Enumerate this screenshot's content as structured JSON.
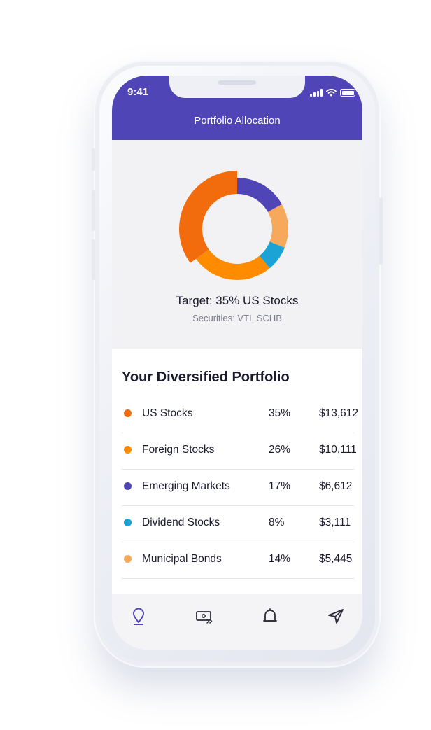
{
  "status_bar": {
    "time": "9:41"
  },
  "header": {
    "title": "Portfolio Allocation"
  },
  "chart_data": {
    "type": "pie",
    "categories": [
      "US Stocks",
      "Foreign Stocks",
      "Emerging Markets",
      "Dividend Stocks",
      "Municipal Bonds"
    ],
    "values": [
      35,
      26,
      17,
      8,
      14
    ],
    "highlighted": "US Stocks"
  },
  "target": {
    "label": "Target: 35% US Stocks",
    "securities": "Securities: VTI, SCHB"
  },
  "portfolio": {
    "heading": "Your Diversified Portfolio",
    "rows": [
      {
        "name": "US Stocks",
        "percent": "35%",
        "amount": "$13,612",
        "color": "#f26c0d"
      },
      {
        "name": "Foreign Stocks",
        "percent": "26%",
        "amount": "$10,111",
        "color": "#ff8c00"
      },
      {
        "name": "Emerging Markets",
        "percent": "17%",
        "amount": "$6,612",
        "color": "#4f45b6"
      },
      {
        "name": "Dividend Stocks",
        "percent": "8%",
        "amount": "$3,111",
        "color": "#1aa3d4"
      },
      {
        "name": "Municipal Bonds",
        "percent": "14%",
        "amount": "$5,445",
        "color": "#f7a95b"
      }
    ]
  },
  "nav": {
    "items": [
      {
        "icon": "location-pin-icon",
        "active": true
      },
      {
        "icon": "money-transfer-icon",
        "active": false
      },
      {
        "icon": "bell-icon",
        "active": false
      },
      {
        "icon": "send-icon",
        "active": false
      }
    ]
  },
  "colors": {
    "header": "#4f45b6",
    "accent": "#4f45b6",
    "chart_background": "#f2f2f4"
  }
}
